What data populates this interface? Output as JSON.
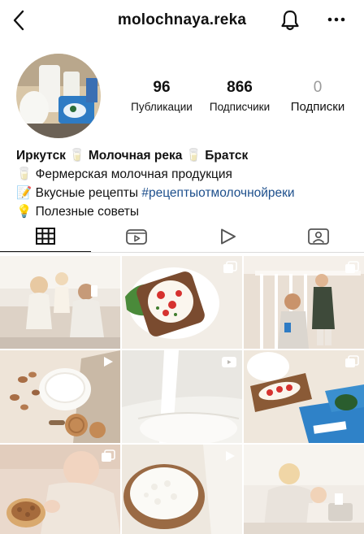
{
  "header": {
    "username": "molochnaya.reka"
  },
  "stats": [
    {
      "value": "96",
      "label": "Публикации"
    },
    {
      "value": "866",
      "label": "Подписчики"
    },
    {
      "value": "0",
      "label": "Подписки"
    }
  ],
  "bio": {
    "name_line": "Иркутск 🥛 Молочная река 🥛 Братск",
    "line1": "🥛 Фермерская молочная продукция",
    "line2_text": "📝 Вкусные рецепты ",
    "line2_hashtag": "#рецептыотмолочнойреки",
    "line3": "💡 Полезные советы"
  },
  "tabs": [
    {
      "icon": "grid-icon",
      "active": true
    },
    {
      "icon": "igtv-icon",
      "active": false
    },
    {
      "icon": "reels-play-icon",
      "active": false
    },
    {
      "icon": "tagged-person-icon",
      "active": false
    }
  ],
  "posts": [
    {
      "scene": "family-kitchen-milk",
      "badge": "none"
    },
    {
      "scene": "toast-cream-pepper",
      "badge": "carousel-icon"
    },
    {
      "scene": "man-child-stairs",
      "badge": "carousel-icon"
    },
    {
      "scene": "milk-bowl-nuts-cookies",
      "badge": "video-icon"
    },
    {
      "scene": "milk-pour-closeup",
      "badge": "igtv-icon"
    },
    {
      "scene": "toast-and-milk-packs",
      "badge": "carousel-icon"
    },
    {
      "scene": "baby-with-nuts",
      "badge": "carousel-icon"
    },
    {
      "scene": "cottage-cheese-bowl",
      "badge": "video-icon"
    },
    {
      "scene": "woman-child-living-room",
      "badge": "none"
    }
  ]
}
